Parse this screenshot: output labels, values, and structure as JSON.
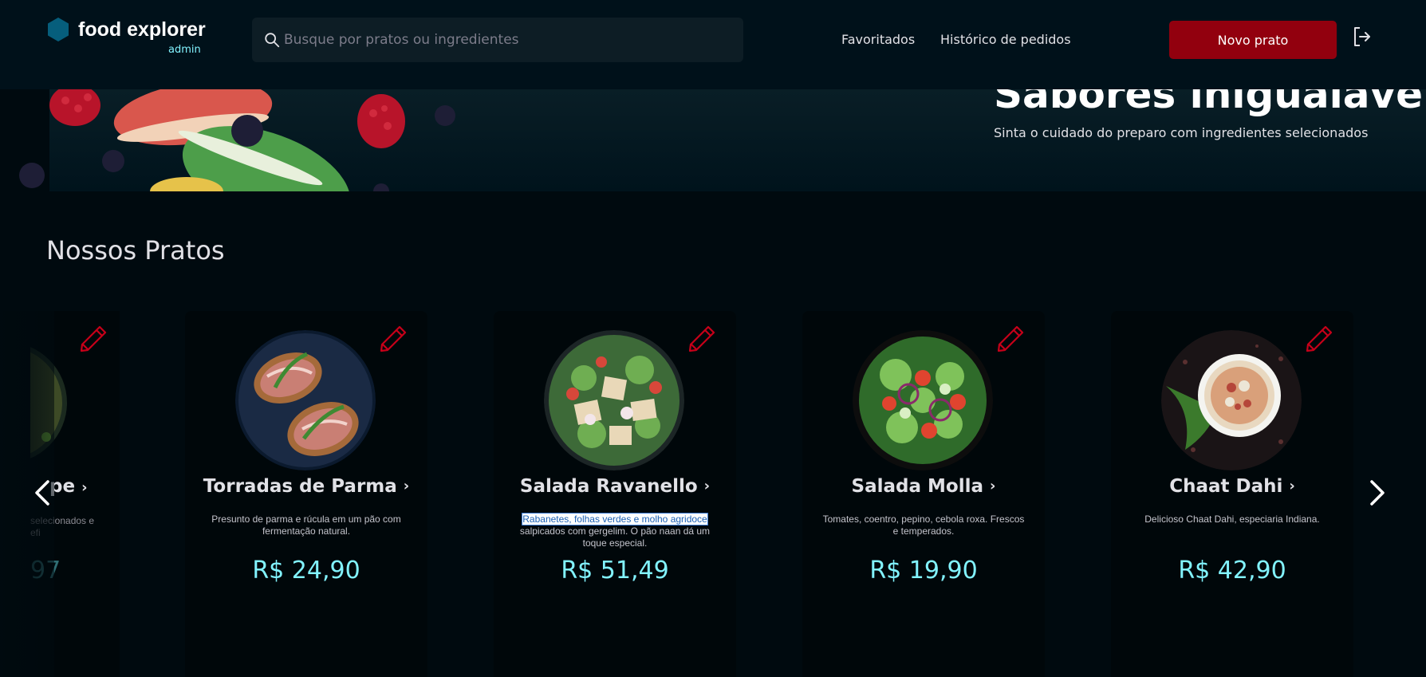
{
  "header": {
    "brand": "food explorer",
    "role": "admin",
    "search_placeholder": "Busque por pratos ou ingredientes",
    "nav": {
      "favorites": "Favoritados",
      "history": "Histórico de pedidos"
    },
    "new_dish_label": "Novo prato"
  },
  "banner": {
    "title": "Sabores inigualáveis",
    "subtitle": "Sinta o cuidado do preparo com ingredientes selecionados"
  },
  "section": {
    "title": "Nossos Pratos"
  },
  "partial_card": {
    "name": "pe",
    "desc_line1": "selecionados e",
    "desc_line2": "efi",
    "price": "97"
  },
  "cards": [
    {
      "name": "Torradas de Parma",
      "description": "Presunto de parma e rúcula em um pão com fermentação natural.",
      "price": "R$ 24,90"
    },
    {
      "name": "Salada Ravanello",
      "description_highlight": "Rabanetes, folhas verdes e molho agridoce",
      "description_rest": "salpicados com gergelim. O pão naan dá um toque especial.",
      "price": "R$ 51,49"
    },
    {
      "name": "Salada Molla",
      "description": "Tomates, coentro, pepino, cebola roxa. Frescos e temperados.",
      "price": "R$ 19,90"
    },
    {
      "name": "Chaat Dahi",
      "description": "Delicioso Chaat Dahi, especiaria Indiana.",
      "price": "R$ 42,90"
    }
  ],
  "colors": {
    "accent_cyan": "#82f3ff",
    "button_red": "#92000e",
    "edit_icon_red": "#c70019",
    "header_bg": "#00111a",
    "page_bg": "#000a0f"
  }
}
